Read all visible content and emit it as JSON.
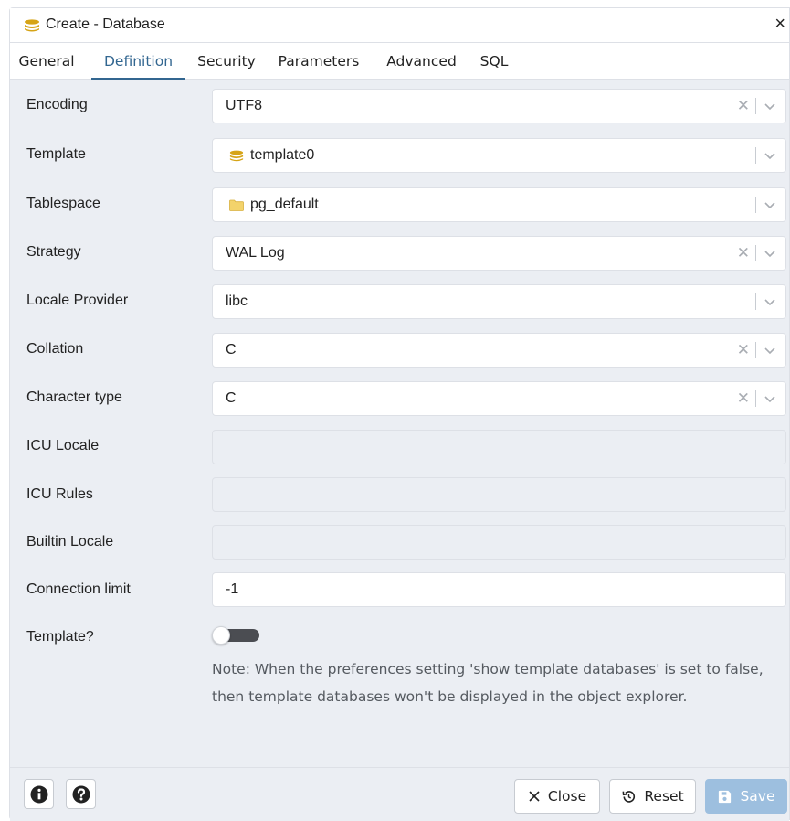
{
  "dialog": {
    "title": "Create - Database",
    "close_glyph": "×"
  },
  "tabs": [
    {
      "label": "General",
      "active": false
    },
    {
      "label": "Definition",
      "active": true
    },
    {
      "label": "Security",
      "active": false
    },
    {
      "label": "Parameters",
      "active": false
    },
    {
      "label": "Advanced",
      "active": false
    },
    {
      "label": "SQL",
      "active": false
    }
  ],
  "form": {
    "encoding": {
      "label": "Encoding",
      "value": "UTF8"
    },
    "template": {
      "label": "Template",
      "value": "template0",
      "icon": "database-icon"
    },
    "tablespace": {
      "label": "Tablespace",
      "value": "pg_default",
      "icon": "folder-icon"
    },
    "strategy": {
      "label": "Strategy",
      "value": "WAL Log"
    },
    "locale_provider": {
      "label": "Locale Provider",
      "value": "libc"
    },
    "collation": {
      "label": "Collation",
      "value": "C"
    },
    "character_type": {
      "label": "Character type",
      "value": "C"
    },
    "icu_locale": {
      "label": "ICU Locale",
      "value": ""
    },
    "icu_rules": {
      "label": "ICU Rules",
      "value": ""
    },
    "builtin_locale": {
      "label": "Builtin Locale",
      "value": ""
    },
    "connection_limit": {
      "label": "Connection limit",
      "value": "-1"
    },
    "is_template": {
      "label": "Template?",
      "checked": false
    },
    "note": "Note: When the preferences setting 'show template databases' is set to false, then template databases won't be displayed in the object explorer."
  },
  "footer": {
    "info_icon": "info-icon",
    "help_icon": "help-icon",
    "close_label": "Close",
    "reset_label": "Reset",
    "save_label": "Save"
  },
  "colors": {
    "accent": "#326690",
    "panel_bg": "#ebeef3",
    "save_bg": "#9dbfdf",
    "db_icon": "#d6a417",
    "folder_icon": "#f3d36b"
  }
}
